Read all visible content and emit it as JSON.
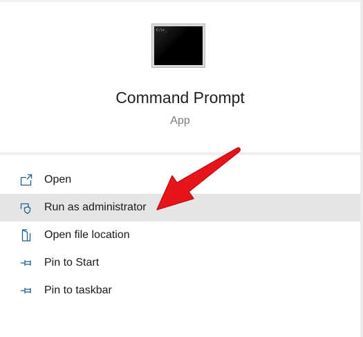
{
  "app": {
    "icon": "command-prompt-app-icon",
    "icon_prompt_text": "C:\\>_",
    "title": "Command Prompt",
    "subtitle": "App"
  },
  "menu": {
    "items": [
      {
        "label": "Open",
        "icon": "open-window-icon"
      },
      {
        "label": "Run as administrator",
        "icon": "shield-icon",
        "highlighted": true
      },
      {
        "label": "Open file location",
        "icon": "file-location-icon"
      },
      {
        "label": "Pin to Start",
        "icon": "pin-icon"
      },
      {
        "label": "Pin to taskbar",
        "icon": "pin-icon"
      }
    ]
  },
  "colors": {
    "icon_stroke": "#1f5d8f",
    "highlight_bg": "#e5e5e5",
    "annotation_arrow": "#e8141c"
  }
}
